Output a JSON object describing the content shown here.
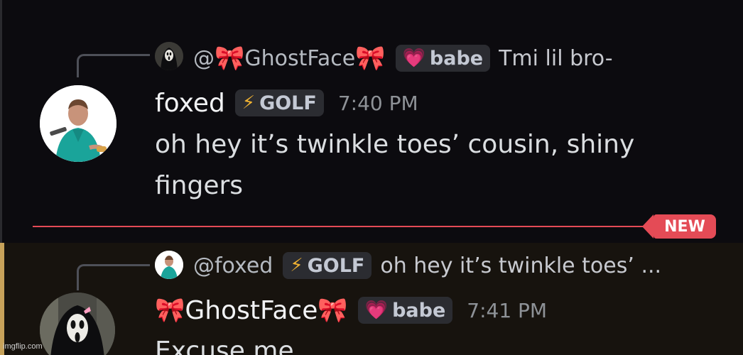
{
  "message1": {
    "reply": {
      "mention_prefix": "@",
      "mention_name": "GhostFace",
      "role_tag": "babe",
      "preview": "Tmi lil bro-"
    },
    "author": "foxed",
    "role_tag": "GOLF",
    "time": "7:40 PM",
    "text_line1": "oh hey it’s twinkle toes’ cousin, shiny",
    "text_line2": "fingers"
  },
  "divider": {
    "label": "NEW",
    "color": "#e44b56"
  },
  "message2": {
    "reply": {
      "mention": "@foxed",
      "role_tag": "GOLF",
      "preview": "oh hey it’s twinkle toes’ ..."
    },
    "author": "GhostFace",
    "role_tag": "babe",
    "time": "7:41 PM",
    "text_partial": "Excuse me"
  },
  "icons": {
    "bow": "🎀",
    "bolt": "⚡",
    "heart": "💗"
  },
  "watermark": "imgflip.com",
  "colors": {
    "background": "#0c0b0f",
    "highlight": "#17130e",
    "highlight_bar": "#c7a25a",
    "tag_bg": "#2b2c31"
  }
}
